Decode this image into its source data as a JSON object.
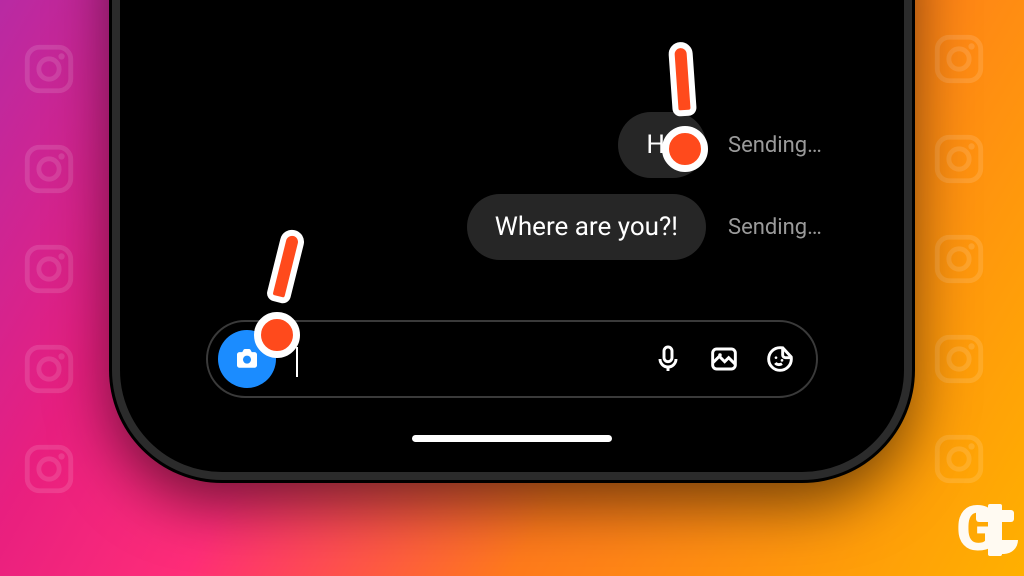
{
  "messages": [
    {
      "text": "Hi!",
      "status": "Sending…"
    },
    {
      "text": "Where are you?!",
      "status": "Sending…"
    }
  ],
  "composer": {
    "placeholder": "",
    "value": ""
  },
  "icons": {
    "camera": "camera-icon",
    "mic": "mic-icon",
    "gallery": "gallery-icon",
    "sticker": "sticker-icon"
  },
  "watermark": "Gt",
  "annotations": [
    "!",
    "!"
  ]
}
